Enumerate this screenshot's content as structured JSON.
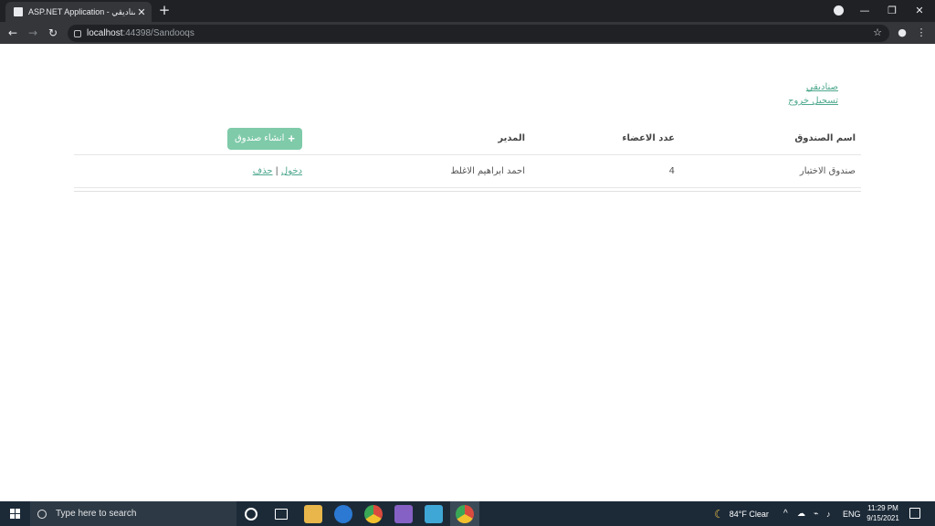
{
  "browser": {
    "tab_title": "ASP.NET Application - صناديقي",
    "tab_close": "✕",
    "new_tab": "+",
    "url_host": "localhost",
    "url_rest": ":44398/Sandooqs"
  },
  "nav": {
    "links": [
      "صناديقي",
      "تسجيل خروج"
    ]
  },
  "table": {
    "headers": {
      "name": "اسم الصندوق",
      "count": "عدد الاعضاء",
      "manager": "المدير"
    },
    "create_button": "انشاء صندوق",
    "create_icon": "+",
    "rows": [
      {
        "name": "صندوق الاختبار",
        "count": "4",
        "manager": "احمد ابراهيم الاغلط",
        "enter": "دخول",
        "separator": "|",
        "delete": "حذف"
      }
    ]
  },
  "taskbar": {
    "search_placeholder": "Type here to search",
    "weather": "84°F  Clear",
    "lang": "ENG",
    "time": "11:29 PM",
    "date": "9/15/2021"
  },
  "colors": {
    "accent": "#7fcaa9",
    "link": "#4ea88e",
    "chrome_dark": "#202124",
    "taskbar": "#1c2a38"
  }
}
